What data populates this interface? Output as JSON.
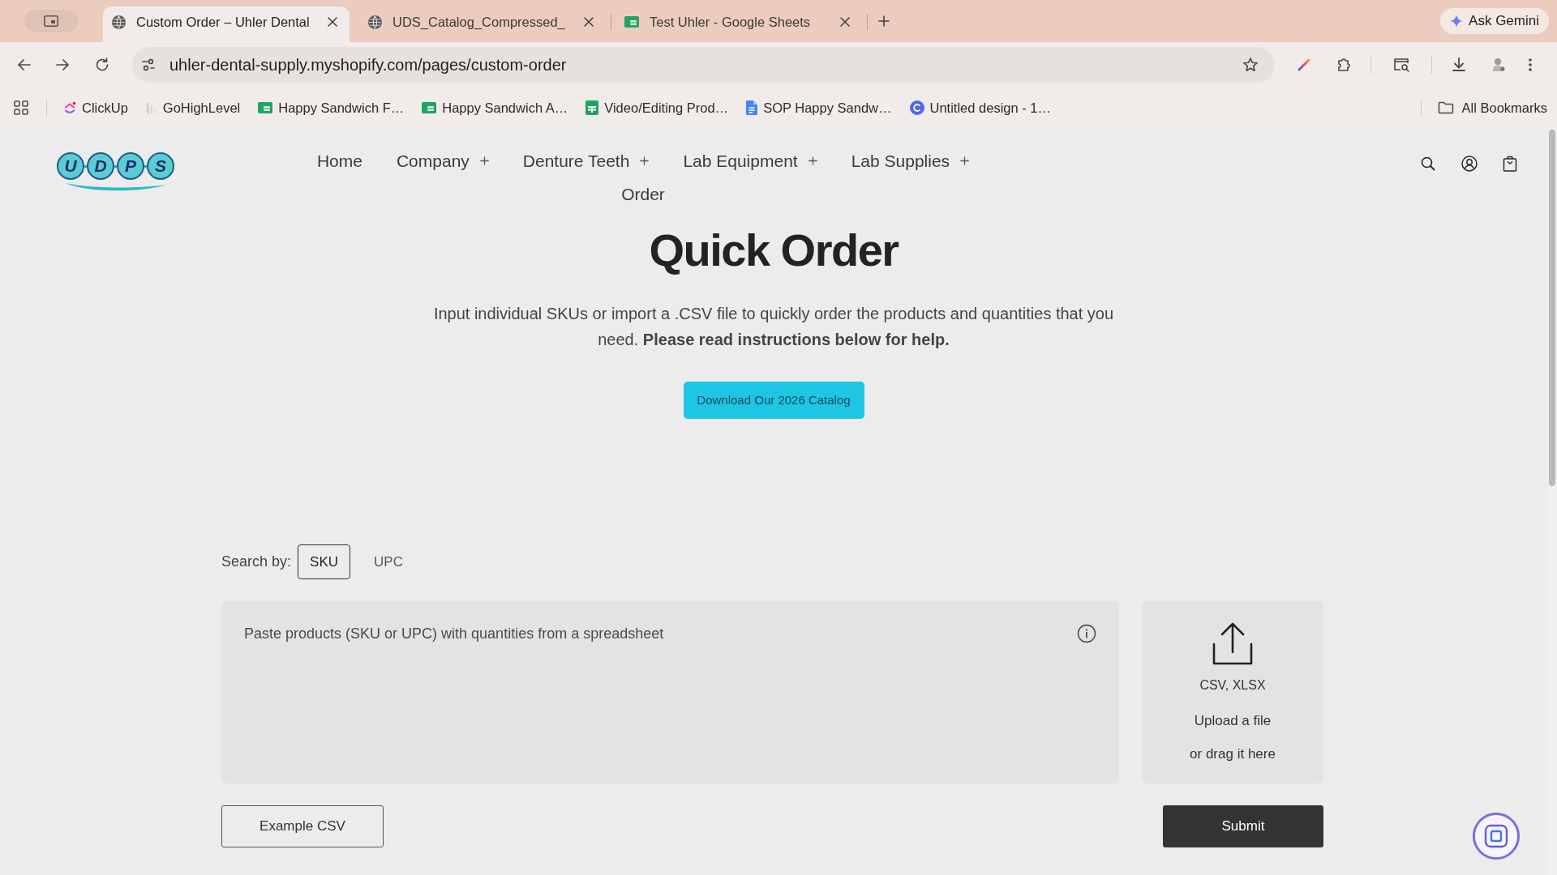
{
  "browser": {
    "tabs": [
      {
        "kind": "page",
        "title": "Custom Order – Uhler Dental",
        "selected": true
      },
      {
        "kind": "page",
        "title": "UDS_Catalog_Compressed_",
        "selected": false
      },
      {
        "kind": "spreadsheet",
        "title": "Test Uhler - Google Sheets",
        "selected": false
      }
    ],
    "assistant_button": "Ask Gemini",
    "address": "uhler-dental-supply.myshopify.com/pages/custom-order",
    "bookmarks": [
      {
        "kind": "chevron",
        "label": "ClickUp"
      },
      {
        "kind": "bars",
        "label": "GoHighLevel"
      },
      {
        "kind": "sheet",
        "label": "Happy Sandwich F…"
      },
      {
        "kind": "sheet",
        "label": "Happy Sandwich A…"
      },
      {
        "kind": "table",
        "label": "Video/Editing Prod…"
      },
      {
        "kind": "document",
        "label": "SOP Happy Sandw…"
      },
      {
        "kind": "circle",
        "label": "Untitled design - 1…"
      }
    ],
    "all_bookmarks": "All Bookmarks"
  },
  "site_header": {
    "logo_letters": [
      "U",
      "D",
      "P",
      "S"
    ],
    "nav": [
      {
        "label": "Home",
        "has_submenu": false
      },
      {
        "label": "Company",
        "has_submenu": true
      },
      {
        "label": "Denture Teeth",
        "has_submenu": true
      },
      {
        "label": "Lab Equipment",
        "has_submenu": true
      },
      {
        "label": "Lab Supplies",
        "has_submenu": true
      },
      {
        "label": "Order",
        "has_submenu": false
      }
    ]
  },
  "hero": {
    "title": "Quick Order",
    "intro": "Input individual SKUs or import a .CSV file to quickly order the products and quantities that you need. **Please read instructions below for help.**",
    "catalog_button": "Download Our 2026 Catalog"
  },
  "order_form": {
    "search_by_label": "Search by:",
    "search_options": [
      {
        "label": "SKU",
        "selected": true
      },
      {
        "label": "UPC",
        "selected": false
      }
    ],
    "paste_field": {
      "placeholder": "Paste products (SKU or UPC) with quantities from a spreadsheet"
    },
    "upload": {
      "formats": "CSV, XLSX",
      "action": "Upload a file",
      "hint": "or drag it here"
    },
    "example_button": "Example CSV",
    "submit_button": "Submit"
  }
}
